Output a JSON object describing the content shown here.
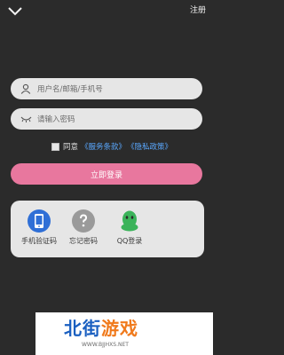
{
  "header": {
    "back_icon": "chevron-down-icon",
    "register_label": "注册"
  },
  "form": {
    "username_placeholder": "用户名/邮箱/手机号",
    "username_icon": "user-icon",
    "password_placeholder": "请输入密码",
    "password_icon": "eye-closed-icon",
    "agree_label": "同意",
    "terms_link": "《服务条款》",
    "privacy_link": "《隐私政策》",
    "agree_checked": false,
    "login_button": "立即登录"
  },
  "alt_login": {
    "items": [
      {
        "label": "手机验证码",
        "icon": "phone-icon"
      },
      {
        "label": "忘记密码",
        "icon": "question-icon"
      },
      {
        "label": "QQ登录",
        "icon": "qq-icon"
      }
    ]
  },
  "watermark": {
    "brand_part1": "北街",
    "brand_part2": "游戏",
    "url": "WWW.BJJHXS.NET"
  },
  "colors": {
    "background": "#2b2b2b",
    "field": "#e6e6e6",
    "login_button": "#e8779e",
    "link": "#5aa8ff"
  }
}
